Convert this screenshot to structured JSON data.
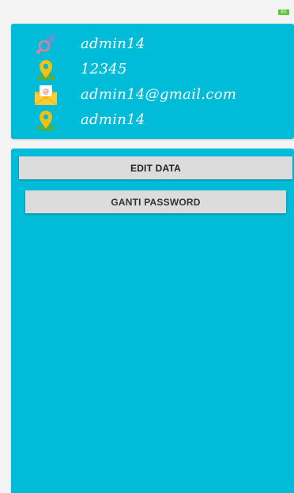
{
  "status_bar": {
    "battery_level": "85"
  },
  "profile": {
    "gender_value": "admin14",
    "phone_value": "12345",
    "email_value": "admin14@gmail.com",
    "address_value": "admin14"
  },
  "actions": {
    "edit_label": "EDIT DATA",
    "change_password_label": "GANTI PASSWORD"
  },
  "colors": {
    "card": "#00bcd8",
    "button": "#dcdcdc",
    "battery": "#5cc33a"
  },
  "icons": [
    "gender-icon",
    "location-pin-icon",
    "email-envelope-icon",
    "location-pin-icon"
  ]
}
